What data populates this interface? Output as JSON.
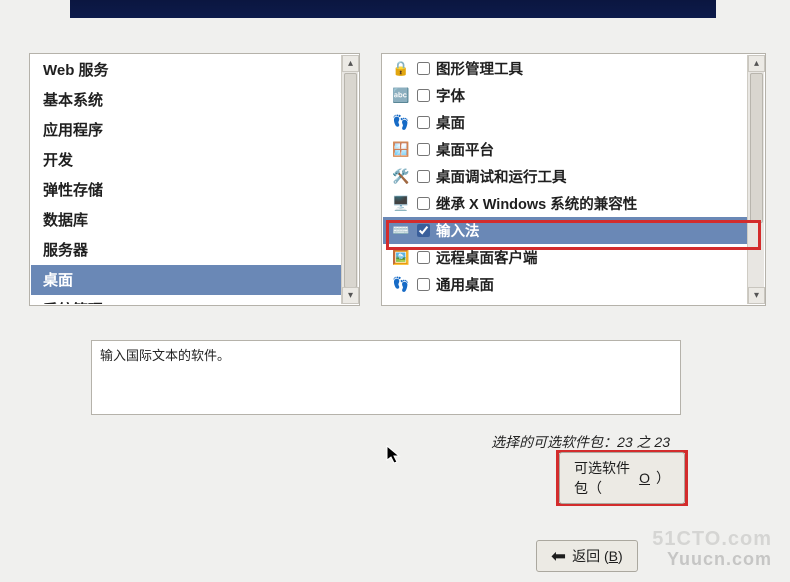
{
  "left_list": {
    "items": [
      {
        "label": "Web 服务",
        "selected": false
      },
      {
        "label": "基本系统",
        "selected": false
      },
      {
        "label": "应用程序",
        "selected": false
      },
      {
        "label": "开发",
        "selected": false
      },
      {
        "label": "弹性存储",
        "selected": false
      },
      {
        "label": "数据库",
        "selected": false
      },
      {
        "label": "服务器",
        "selected": false
      },
      {
        "label": "桌面",
        "selected": true
      },
      {
        "label": "系统管理",
        "selected": false
      }
    ]
  },
  "right_list": {
    "items": [
      {
        "icon": "lock",
        "checked": false,
        "label": "图形管理工具",
        "highlighted": false
      },
      {
        "icon": "font",
        "checked": false,
        "label": "字体",
        "highlighted": false
      },
      {
        "icon": "gnome-foot",
        "checked": false,
        "label": "桌面",
        "highlighted": false
      },
      {
        "icon": "window",
        "checked": false,
        "label": "桌面平台",
        "highlighted": false
      },
      {
        "icon": "tools",
        "checked": false,
        "label": "桌面调试和运行工具",
        "highlighted": false
      },
      {
        "icon": "monitor",
        "checked": false,
        "label": "继承 X Windows 系统的兼容性",
        "highlighted": false
      },
      {
        "icon": "keyboard",
        "checked": true,
        "label": "输入法",
        "highlighted": true
      },
      {
        "icon": "remote",
        "checked": false,
        "label": "远程桌面客户端",
        "highlighted": false
      },
      {
        "icon": "gnome-foot",
        "checked": false,
        "label": "通用桌面",
        "highlighted": false
      }
    ]
  },
  "description": "输入国际文本的软件。",
  "status": {
    "prefix": "选择",
    "middle": "的可选软件包：",
    "count": "23 之 23"
  },
  "buttons": {
    "optional_packages": {
      "text": "可选软件包（",
      "key": "O",
      "suffix": "）"
    },
    "back": {
      "text": "返回 (",
      "key": "B",
      "suffix": ")"
    }
  },
  "watermark": {
    "line1": "51CTO.com",
    "line2": "Yuucn.com"
  }
}
